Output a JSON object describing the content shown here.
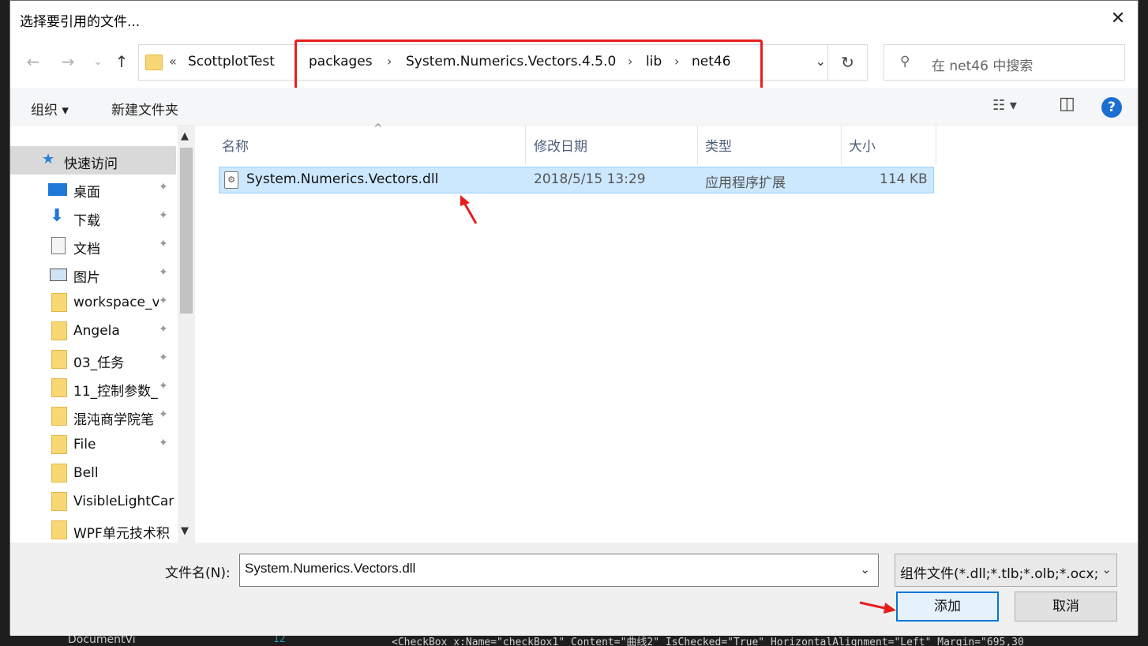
{
  "dialog": {
    "title": "选择要引用的文件...",
    "close_label": "✕"
  },
  "nav": {
    "back_icon": "←",
    "forward_icon": "→",
    "recent_icon": "⌄",
    "up_icon": "↑"
  },
  "address": {
    "prefix": "«",
    "crumbs": [
      "ScottplotTest",
      "packages",
      "System.Numerics.Vectors.4.5.0",
      "lib",
      "net46"
    ],
    "separator": "›",
    "dropdown_icon": "⌄",
    "refresh_icon": "↻"
  },
  "search": {
    "icon": "⚲",
    "placeholder": "在 net46 中搜索"
  },
  "toolbar": {
    "organize_label": "组织 ▾",
    "new_folder_label": "新建文件夹",
    "view_icon": "☷ ▾",
    "pane_icon": "◫",
    "help_label": "?"
  },
  "sidebar": {
    "quick_access": "快速访问",
    "items": [
      {
        "label": "桌面",
        "icon": "desktop-icon",
        "pinned": true
      },
      {
        "label": "下载",
        "icon": "download-icon",
        "pinned": true
      },
      {
        "label": "文档",
        "icon": "document-icon",
        "pinned": true
      },
      {
        "label": "图片",
        "icon": "picture-icon",
        "pinned": true
      },
      {
        "label": "workspace_v",
        "icon": "folder-icon",
        "pinned": true
      },
      {
        "label": "Angela",
        "icon": "folder-icon",
        "pinned": true
      },
      {
        "label": "03_任务",
        "icon": "folder-icon",
        "pinned": true
      },
      {
        "label": "11_控制参数_",
        "icon": "folder-icon",
        "pinned": true
      },
      {
        "label": "混沌商学院笔",
        "icon": "folder-icon",
        "pinned": true
      },
      {
        "label": "File",
        "icon": "folder-icon",
        "pinned": true
      },
      {
        "label": "Bell",
        "icon": "folder-icon",
        "pinned": false
      },
      {
        "label": "VisibleLightCar",
        "icon": "folder-icon",
        "pinned": false
      },
      {
        "label": "WPF单元技术积",
        "icon": "folder-icon",
        "pinned": false
      }
    ],
    "pin_icon": "📌"
  },
  "list": {
    "columns": [
      "名称",
      "修改日期",
      "类型",
      "大小"
    ],
    "sort_icon": "^",
    "rows": [
      {
        "name": "System.Numerics.Vectors.dll",
        "date": "2018/5/15 13:29",
        "type": "应用程序扩展",
        "size": "114 KB"
      }
    ]
  },
  "footer": {
    "filename_label": "文件名(N):",
    "filename_value": "System.Numerics.Vectors.dll",
    "filter_value": "组件文件(*.dll;*.tlb;*.olb;*.ocx;",
    "add_label": "添加",
    "cancel_label": "取消"
  },
  "ide": {
    "tab_label": "DocumentVi",
    "line_number": "12",
    "code_line": "<CheckBox x:Name=\"checkBox1\" Content=\"曲线2\" IsChecked=\"True\" HorizontalAlignment=\"Left\" Margin=\"695,30"
  },
  "colors": {
    "highlight_box": "#e81e1e",
    "selection": "#cce8ff",
    "accent": "#0078d7"
  }
}
